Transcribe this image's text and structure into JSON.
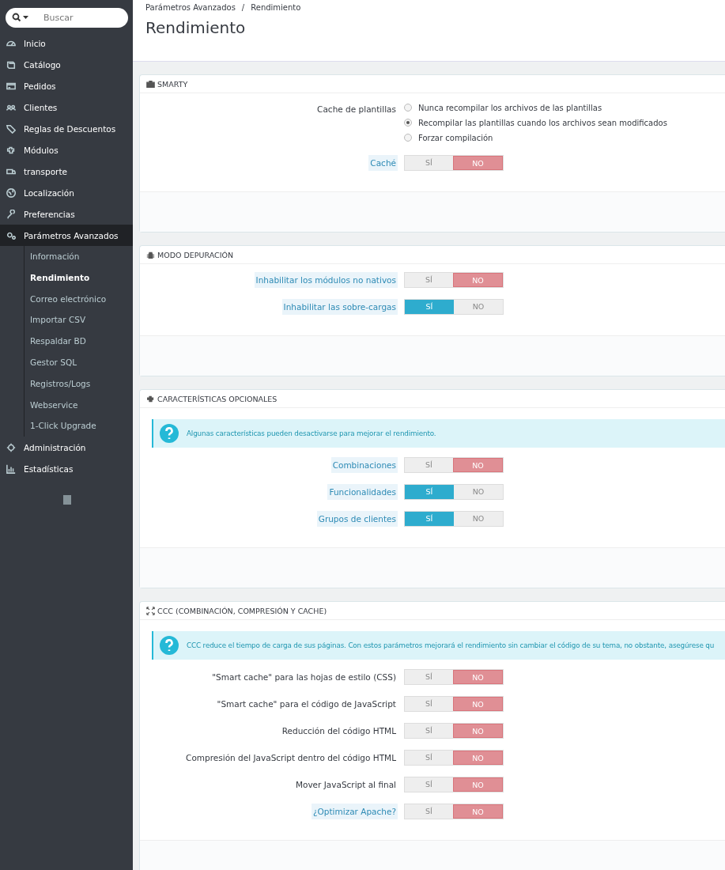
{
  "sidebar": {
    "search_placeholder": "Buscar",
    "items": [
      {
        "label": "Inicio",
        "selected": false
      },
      {
        "label": "Catálogo",
        "selected": false
      },
      {
        "label": "Pedidos",
        "selected": false
      },
      {
        "label": "Clientes",
        "selected": false
      },
      {
        "label": "Reglas de Descuentos",
        "selected": false
      },
      {
        "label": "Módulos",
        "selected": false
      },
      {
        "label": "transporte",
        "selected": false
      },
      {
        "label": "Localización",
        "selected": false
      },
      {
        "label": "Preferencias",
        "selected": false
      },
      {
        "label": "Parámetros Avanzados",
        "selected": true,
        "expanded": true,
        "children": [
          {
            "label": "Información",
            "selected": false
          },
          {
            "label": "Rendimiento",
            "selected": true
          },
          {
            "label": "Correo electrónico",
            "selected": false
          },
          {
            "label": "Importar CSV",
            "selected": false
          },
          {
            "label": "Respaldar BD",
            "selected": false
          },
          {
            "label": "Gestor SQL",
            "selected": false
          },
          {
            "label": "Registros/Logs",
            "selected": false
          },
          {
            "label": "Webservice",
            "selected": false
          },
          {
            "label": "1-Click Upgrade",
            "selected": false
          }
        ]
      },
      {
        "label": "Administración",
        "selected": false
      },
      {
        "label": "Estadísticas",
        "selected": false
      }
    ]
  },
  "header": {
    "breadcrumb": [
      "Parámetros Avanzados",
      "Rendimiento"
    ],
    "breadcrumb_separator": "/",
    "title": "Rendimiento"
  },
  "panels": [
    {
      "title": "SMARTY",
      "rows": [
        {
          "kind": "radio",
          "label": "Cache de plantillas",
          "options": [
            {
              "label": "Nunca recompilar los archivos de las plantillas",
              "selected": false
            },
            {
              "label": "Recompilar las plantillas cuando los archivos sean modificados",
              "selected": true
            },
            {
              "label": "Forzar compilación",
              "selected": false
            }
          ]
        },
        {
          "kind": "switch",
          "label": "Caché",
          "hint": true,
          "on": false,
          "yes": "SÍ",
          "no": "NO"
        }
      ]
    },
    {
      "title": "MODO DEPURACIÓN",
      "rows": [
        {
          "kind": "switch",
          "label": "Inhabilitar los módulos no nativos",
          "hint": true,
          "on": false,
          "yes": "SÍ",
          "no": "NO"
        },
        {
          "kind": "switch",
          "label": "Inhabilitar las sobre-cargas",
          "hint": true,
          "on": true,
          "yes": "SÍ",
          "no": "NO"
        }
      ]
    },
    {
      "title": "CARACTERÍSTICAS OPCIONALES",
      "info": "Algunas características pueden desactivarse para mejorar el rendimiento.",
      "rows": [
        {
          "kind": "switch",
          "label": "Combinaciones",
          "hint": true,
          "on": false,
          "yes": "SÍ",
          "no": "NO"
        },
        {
          "kind": "switch",
          "label": "Funcionalidades",
          "hint": true,
          "on": true,
          "yes": "SÍ",
          "no": "NO"
        },
        {
          "kind": "switch",
          "label": "Grupos de clientes",
          "hint": true,
          "on": true,
          "yes": "SÍ",
          "no": "NO"
        }
      ]
    },
    {
      "title": "CCC (COMBINACIÓN, COMPRESIÓN Y CACHE)",
      "info": "CCC reduce el tiempo de carga de sus páginas. Con estos parámetros mejorará el rendimiento sin cambiar el código de su tema, no obstante, asegúrese qu",
      "rows": [
        {
          "kind": "switch",
          "label": "\"Smart cache\" para las hojas de estilo (CSS)",
          "hint": false,
          "on": false,
          "yes": "SÍ",
          "no": "NO"
        },
        {
          "kind": "switch",
          "label": "\"Smart cache\" para el código de JavaScript",
          "hint": false,
          "on": false,
          "yes": "SÍ",
          "no": "NO"
        },
        {
          "kind": "switch",
          "label": "Reducción del código HTML",
          "hint": false,
          "on": false,
          "yes": "SÍ",
          "no": "NO"
        },
        {
          "kind": "switch",
          "label": "Compresión del JavaScript dentro del código HTML",
          "hint": false,
          "on": false,
          "yes": "SÍ",
          "no": "NO"
        },
        {
          "kind": "switch",
          "label": "Mover JavaScript al final",
          "hint": false,
          "on": false,
          "yes": "SÍ",
          "no": "NO"
        },
        {
          "kind": "switch",
          "label": "¿Optimizar Apache?",
          "hint": true,
          "on": false,
          "yes": "SÍ",
          "no": "NO"
        }
      ]
    }
  ]
}
